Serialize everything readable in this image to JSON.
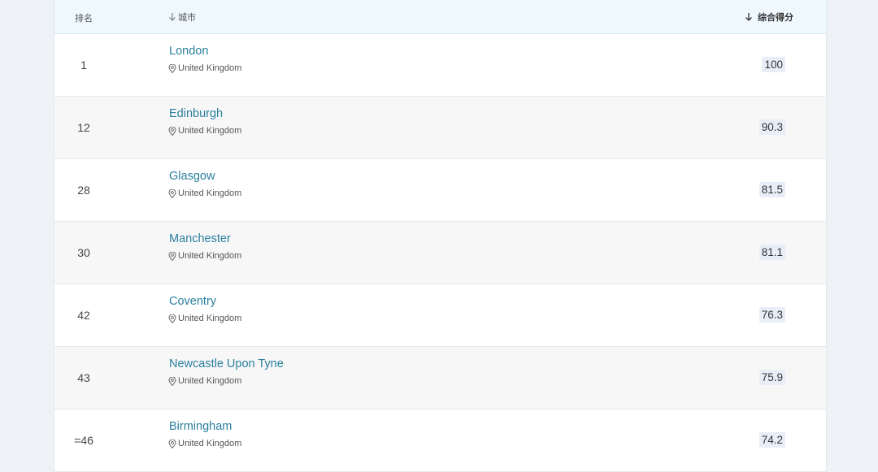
{
  "header": {
    "rank_label": "排名",
    "city_label": "城市",
    "score_label": "综合得分"
  },
  "rows": [
    {
      "rank": "1",
      "city": "London",
      "country": "United Kingdom",
      "score": "100"
    },
    {
      "rank": "12",
      "city": "Edinburgh",
      "country": "United Kingdom",
      "score": "90.3"
    },
    {
      "rank": "28",
      "city": "Glasgow",
      "country": "United Kingdom",
      "score": "81.5"
    },
    {
      "rank": "30",
      "city": "Manchester",
      "country": "United Kingdom",
      "score": "81.1"
    },
    {
      "rank": "42",
      "city": "Coventry",
      "country": "United Kingdom",
      "score": "76.3"
    },
    {
      "rank": "43",
      "city": "Newcastle Upon Tyne",
      "country": "United Kingdom",
      "score": "75.9"
    },
    {
      "rank": "=46",
      "city": "Birmingham",
      "country": "United Kingdom",
      "score": "74.2"
    }
  ],
  "colors": {
    "accent": "#2a7f9e",
    "header_bg": "#eef8fd",
    "score_bg": "#e8eef8",
    "page_bg": "#eef1f6"
  },
  "icons": {
    "sort": "arrow-down-icon",
    "location": "location-pin-icon"
  }
}
